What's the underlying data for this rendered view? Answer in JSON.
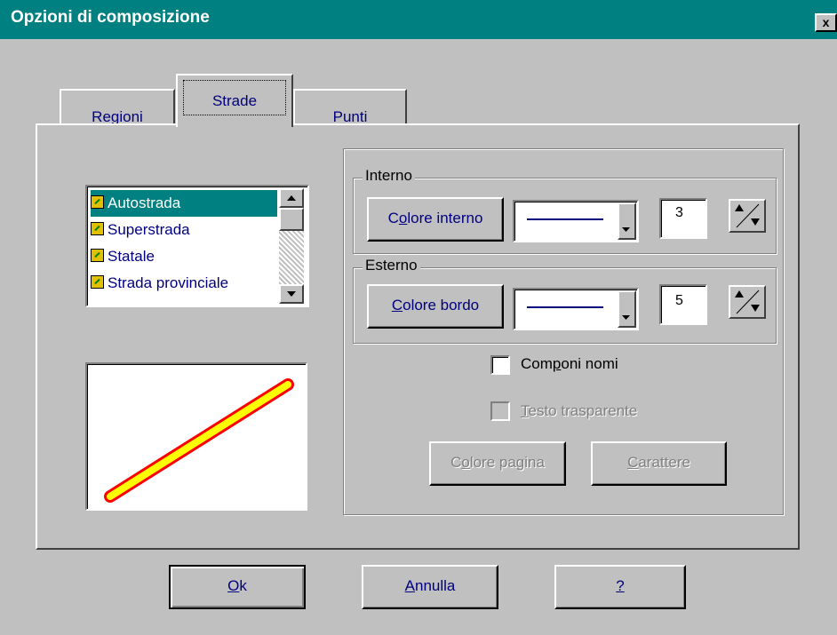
{
  "window": {
    "title": "Opzioni di composizione",
    "close_glyph": "x"
  },
  "tabs": [
    {
      "label": "Regioni"
    },
    {
      "label": "Strade"
    },
    {
      "label": "Punti"
    }
  ],
  "list": {
    "items": [
      {
        "label": "Autostrada",
        "selected": true
      },
      {
        "label": "Superstrada"
      },
      {
        "label": "Statale"
      },
      {
        "label": "Strada provinciale"
      }
    ]
  },
  "preview": {
    "inner_color": "#ffff00",
    "outer_color": "#ff0000"
  },
  "interno": {
    "legend": "Interno",
    "color_button": {
      "pre": "C",
      "ul": "o",
      "post": "lore interno"
    },
    "width": "3"
  },
  "esterno": {
    "legend": "Esterno",
    "color_button": {
      "ul": "C",
      "post": "olore bordo"
    },
    "width": "5"
  },
  "checks": {
    "componi": {
      "pre": "Com",
      "ul": "p",
      "post": "oni nomi",
      "checked": false,
      "enabled": true
    },
    "testo": {
      "ul": "T",
      "post": "esto trasparente",
      "checked": false,
      "enabled": false
    }
  },
  "buttons": {
    "colore_pagina": {
      "pre": "C",
      "ul": "o",
      "post": "lore pagina",
      "enabled": false
    },
    "carattere": {
      "ul": "C",
      "post": "arattere",
      "enabled": false
    },
    "ok": {
      "ul": "O",
      "post": "k"
    },
    "annulla": {
      "ul": "A",
      "post": "nnulla"
    },
    "help": {
      "ul": "?"
    }
  },
  "colors": {
    "title_bar": "#008080",
    "face": "#c0c0c0",
    "selection": "#008080",
    "text_blue": "#00007f"
  }
}
